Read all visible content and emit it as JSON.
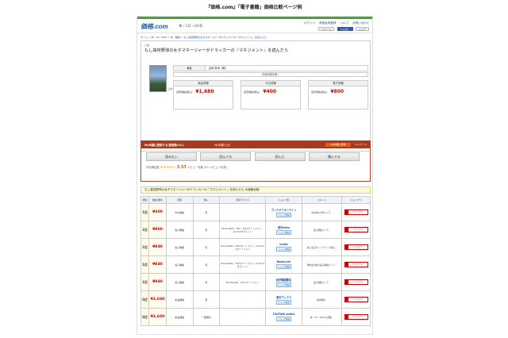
{
  "caption": "『価格.com』「電子書籍」価格比較ページ例",
  "header": {
    "logo": "価格.com",
    "subsite": "本・CD・DVD",
    "links": [
      "ログイン",
      "新規会員登録",
      "ヘルプ",
      "お問い合わせ"
    ],
    "buttons": {
      "tweet": "ツイート",
      "like": "いいね！",
      "share": "シェア"
    }
  },
  "breadcrumb": "ホーム > 本・CD・DVD > 本・雑誌 > もし高校野球の女子マネージャーがドラッカーの『マネジメント』を読んだら",
  "product": {
    "category": "小説",
    "title": "もし高校野球の女子マネージャーがドラッカーの『マネジメント』を読んだら",
    "image_caption": "画像",
    "author_key": "著者",
    "author_value": "岩崎 夏海【著】",
    "expand_label": "作品情報を開く",
    "formats": [
      {
        "name": "新品書籍",
        "price_label": "最安価格(税込):",
        "price": "¥1,680"
      },
      {
        "name": "中古書籍",
        "price_label": "最安価格(税込):",
        "price": "¥400"
      },
      {
        "name": "電子書籍",
        "price_label": "最安価格(税込):",
        "price": "¥800"
      }
    ],
    "bookmark": "お気に入りに登録"
  },
  "mybook": {
    "title": "My本棚に登録する(登録数:0人)",
    "help": "My本棚とは？",
    "register": "My本棚に登録",
    "mypage": "マイページ",
    "actions": [
      "読みたい",
      "読んでる",
      "読んだ",
      "積んでる"
    ],
    "rating_label": "平均満足度",
    "rating_value": "3.57",
    "reviews": "レビュー件数: 8人",
    "write_link": "レビューを書く"
  },
  "comparison": {
    "title": "もし高校野球の女子マネージャーがドラッカーの『マネジメント』を読んだら の価格比較",
    "headers": [
      "順位",
      "価格(送料)",
      "形態",
      "購入",
      "対応デバイス",
      "ショップ名",
      "コメント",
      "ショップへ"
    ],
    "go_label": "ショップへ",
    "rows": [
      {
        "rank": "1位",
        "price": "¥400",
        "format": "中古書籍",
        "purchase": "有",
        "device": "-",
        "shop": "ブックオフオンライン",
        "badge": "ショップ情報",
        "note": "中古本の大型ストア。"
      },
      {
        "rank": "1位",
        "price": "¥800",
        "format": "電子書籍",
        "purchase": "有",
        "device": "WindowsPC、Mac、iOSスマートフォン、Androidタブレット",
        "shop": "楽天kobo",
        "badge": "ショップ情報",
        "note": "電子書籍ストア。"
      },
      {
        "rank": "1位",
        "price": "¥840",
        "format": "電子書籍",
        "purchase": "有",
        "device": "WindowsPC、iOSスマートフォン、Androidスマートフォン",
        "shop": "honto",
        "badge": "ショップ情報",
        "note": "紙と電子のハイブリッド書店。"
      },
      {
        "rank": "1位",
        "price": "¥840",
        "format": "電子書籍",
        "purchase": "有",
        "device": "WindowsPC、iOSスマートフォン、Androidタブレット",
        "shop": "BookLive!",
        "badge": "ショップ情報",
        "note": "国内最大級の電子書籍ストア。"
      },
      {
        "rank": "1位",
        "price": "¥840",
        "format": "電子書籍",
        "purchase": "有",
        "device": "WindowsPC、iOSスマートフォン",
        "shop": "紀伊國屋書店",
        "badge": "ショップ情報",
        "note": "電子書籍ストア。"
      },
      {
        "rank": "6位",
        "price": "¥1,680",
        "format": "新品書籍",
        "purchase": "有",
        "device": "-",
        "shop": "楽天ブックス",
        "badge": "ショップ情報",
        "note": "送料無料。"
      },
      {
        "rank": "6位",
        "price": "¥1,680",
        "format": "新品書籍",
        "purchase": "一部無料",
        "device": "-",
        "shop": "TSUTAYA online",
        "badge": "ショップ情報",
        "note": "本・CD・DVD の通販。"
      },
      {
        "rank": "6位",
        "price": "¥1,680",
        "format": "新品書籍",
        "purchase": "有",
        "device": "-",
        "shop": "Yahoo!shopping",
        "badge": "ショップ情報",
        "note": "ポイントが貯まる。"
      }
    ]
  }
}
